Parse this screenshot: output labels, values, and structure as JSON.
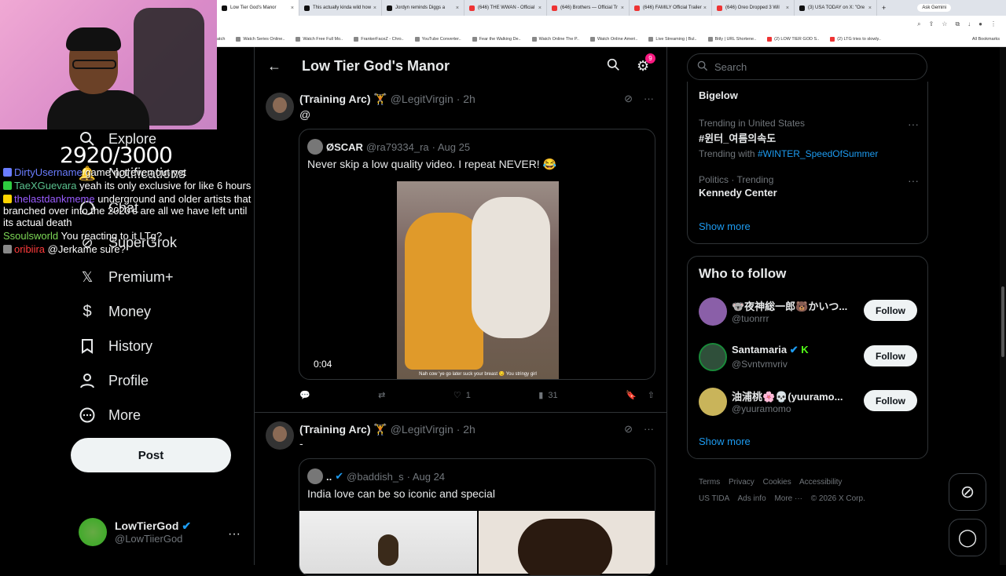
{
  "browser": {
    "tabs": [
      {
        "label": "Low Tier God's Manor",
        "active": true
      },
      {
        "label": "This actually kinda wild how"
      },
      {
        "label": "Jordyn reminds Diggs a"
      },
      {
        "label": "(646) THE WWAN - Official"
      },
      {
        "label": "(646) Brothers — Official Tr"
      },
      {
        "label": "(646) FAMILY Official Trailer"
      },
      {
        "label": "(646) Oreo Dropped 3 Wil"
      },
      {
        "label": "(3) USA TODAY on X: \"Ore"
      }
    ],
    "ask_gemini": "Ask Gemini",
    "bookmarks": [
      "atch",
      "Watch Series Online..",
      "Watch Free Full Mo..",
      "FrankerFaceZ - Chro..",
      "YouTube Converter..",
      "Fear the Walking De..",
      "Watch Online The P..",
      "Watch Online Ameri..",
      "Live Streaming | Bul..",
      "Bitly | URL Shortene..",
      "(2) LOW TIER GOD S..",
      "(2) LTG tries to slowly.."
    ],
    "all_bookmarks": "All Bookmarks"
  },
  "overlay": {
    "counter": "2920/3000",
    "chat": [
      {
        "user": "DirtyUsername",
        "color": "#6a7dff",
        "text": "game not even out yet"
      },
      {
        "user": "TaeXGuevara",
        "color": "#5ac18e",
        "text": "yeah its only exclusive for like 6 hours"
      },
      {
        "user": "thelastdankmeme",
        "color": "#9a5cff",
        "text": "underground and older artists that branched over into the 2020's are all we have left until its actual death"
      },
      {
        "user": "Ssoulsworld",
        "color": "#7ed957",
        "text": "You reacting to it LTg?"
      },
      {
        "user": "oribiira",
        "color": "#ff3b3b",
        "text": "@Jerkame sure?"
      }
    ]
  },
  "nav": {
    "items": [
      {
        "label": "Explore",
        "icon": "search-icon"
      },
      {
        "label": "Notifications",
        "icon": "bell-icon"
      },
      {
        "label": "Chat",
        "icon": "chat-icon"
      },
      {
        "label": "SuperGrok",
        "icon": "grok-icon"
      },
      {
        "label": "Premium+",
        "icon": "x-icon"
      },
      {
        "label": "Money",
        "icon": "dollar-icon"
      },
      {
        "label": "History",
        "icon": "bookmark-icon"
      },
      {
        "label": "Profile",
        "icon": "person-icon"
      },
      {
        "label": "More",
        "icon": "more-circle-icon"
      }
    ],
    "notif_badge": "3",
    "post_label": "Post",
    "account": {
      "name": "LowTierGod",
      "handle": "@LowTiierGod"
    }
  },
  "header": {
    "title": "Low Tier God's Manor",
    "notif_count": "9"
  },
  "tweets": [
    {
      "name": "(Training Arc) 🏋",
      "handle": "@LegitVirgin",
      "time": "· 2h",
      "text": "@",
      "quote": {
        "name": "ØSCAR",
        "handle": "@ra79334_ra",
        "time": "· Aug 25",
        "text": "Never skip a low quality video. I repeat NEVER! 😂",
        "video_caption": "Nah cow 'ye go later suck your breast 😏 You stringy girl",
        "video_time": "0:04"
      },
      "actions": {
        "reply": "",
        "repost": "",
        "like": "1",
        "views": "31"
      }
    },
    {
      "name": "(Training Arc) 🏋",
      "handle": "@LegitVirgin",
      "time": "· 2h",
      "text": "-",
      "quote": {
        "name": "..",
        "handle": "@baddish_s",
        "time": "· Aug 24",
        "text": "India love can be so iconic and special"
      }
    }
  ],
  "sidebar": {
    "search_placeholder": "Search",
    "trends": [
      {
        "category": "",
        "name": "Bigelow",
        "sub": ""
      },
      {
        "category": "Trending in United States",
        "name": "#윈터_여름의속도",
        "sub_prefix": "Trending with ",
        "sub_link": "#WINTER_SpeedOfSummer"
      },
      {
        "category": "Politics · Trending",
        "name": "Kennedy Center"
      }
    ],
    "show_more": "Show more",
    "who_to_follow": "Who to follow",
    "follow_suggestions": [
      {
        "name": "🐨夜神総一郎🐻かいつ...",
        "handle": "@tuonrrr",
        "avatar_color": "#8a5fa8"
      },
      {
        "name": "Santamaria",
        "handle": "@Svntvmvriv",
        "avatar_color": "#2f4f3a"
      },
      {
        "name": "油浦桃🌸💀(yuuramo...",
        "handle": "@yuuramomo",
        "avatar_color": "#c9b45a"
      }
    ],
    "follow_label": "Follow",
    "footer": [
      "Terms",
      "Privacy",
      "Cookies",
      "Accessibility",
      "US TIDA",
      "Ads info",
      "More ···",
      "© 2026 X Corp."
    ]
  }
}
